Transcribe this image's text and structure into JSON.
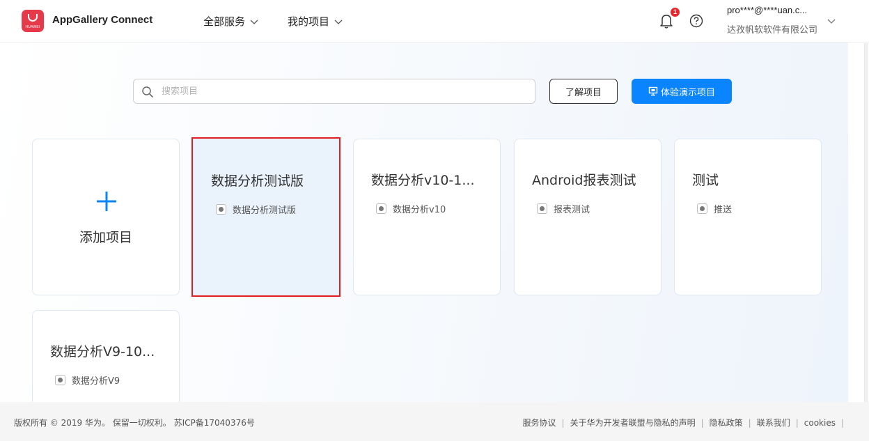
{
  "header": {
    "logo_text": "HUAWEI",
    "app_title": "AppGallery Connect",
    "nav": [
      {
        "label": "全部服务"
      },
      {
        "label": "我的项目"
      }
    ],
    "notification_count": "1",
    "account_email": "pro****@****uan.c...",
    "account_company": "达孜帆软软件有限公司"
  },
  "toolbar": {
    "search_placeholder": "搜索项目",
    "learn_label": "了解项目",
    "demo_label": "体验演示项目"
  },
  "add_card": {
    "label": "添加项目"
  },
  "projects": [
    {
      "name": "数据分析测试版",
      "app": "数据分析测试版",
      "selected": true
    },
    {
      "name": "数据分析v10-1...",
      "app": "数据分析v10",
      "selected": false
    },
    {
      "name": "Android报表测试",
      "app": "报表测试",
      "selected": false
    },
    {
      "name": "测试",
      "app": "推送",
      "selected": false
    },
    {
      "name": "数据分析V9-10...",
      "app": "数据分析V9",
      "selected": false
    }
  ],
  "footer": {
    "copyright": "版权所有 © 2019 华为。 保留一切权利。 苏ICP备17040376号",
    "links": [
      "服务协议",
      "关于华为开发者联盟与隐私的声明",
      "隐私政策",
      "联系我们",
      "cookies"
    ]
  },
  "colors": {
    "accent": "#0a84ff",
    "brand": "#e6394a",
    "selection_border": "#e02020",
    "badge": "#e8262c"
  },
  "icons": [
    "huawei-logo",
    "chevron-down-icon",
    "bell-icon",
    "help-icon",
    "search-icon",
    "presentation-icon",
    "plus-icon",
    "android-app-icon"
  ]
}
